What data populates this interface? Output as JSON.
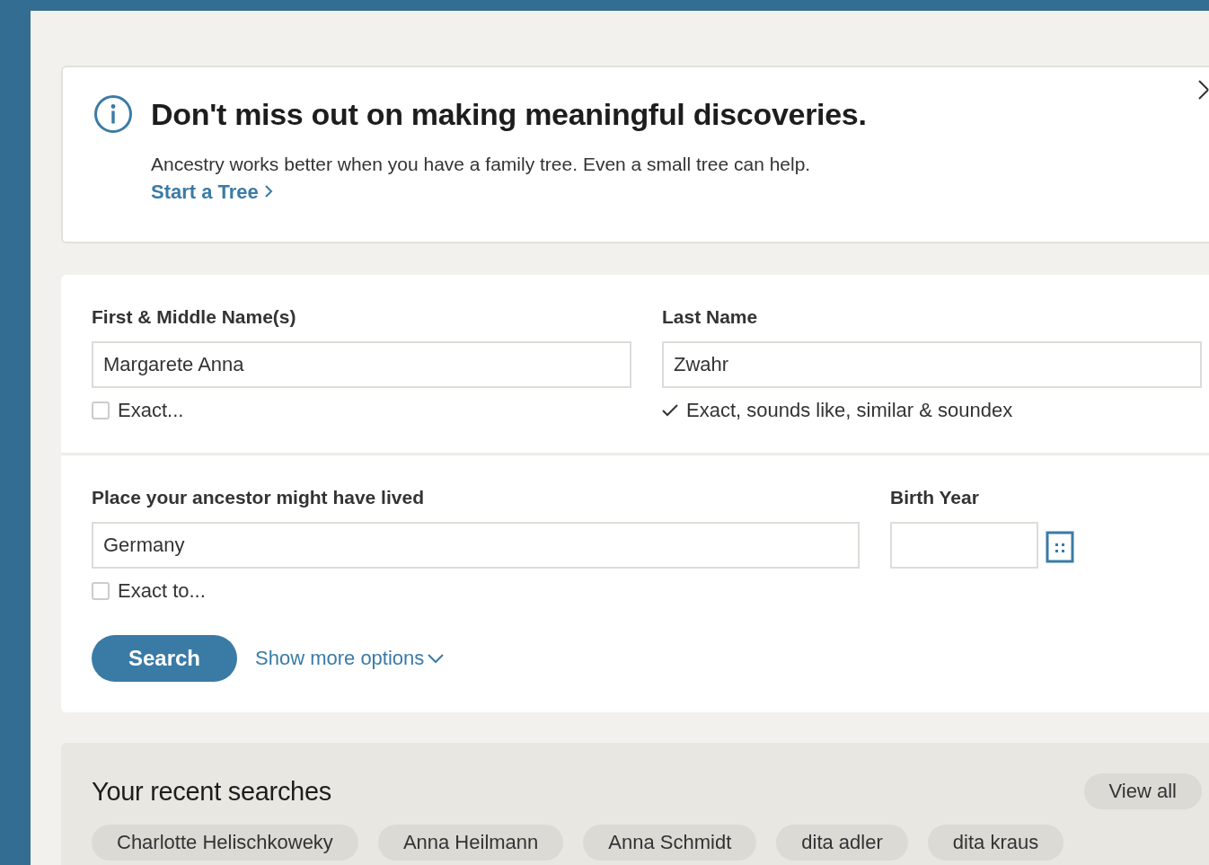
{
  "banner": {
    "title": "Don't miss out on making meaningful discoveries.",
    "message": "Ancestry works better when you have a family tree. Even a small tree can help.",
    "link": "Start a Tree"
  },
  "search_form": {
    "first_name": {
      "label": "First & Middle Name(s)",
      "value": "Margarete Anna",
      "exact": {
        "label": "Exact...",
        "checked": false
      }
    },
    "last_name": {
      "label": "Last Name",
      "value": "Zwahr",
      "match_note": "Exact, sounds like, similar & soundex"
    },
    "place": {
      "label": "Place your ancestor might have lived",
      "value": "Germany",
      "exact": {
        "label": "Exact to...",
        "checked": false
      }
    },
    "birth_year": {
      "label": "Birth Year"
    },
    "search_button": "Search",
    "more_options": "Show more options"
  },
  "recent_searches": {
    "title": "Your recent searches",
    "view_all": "View all",
    "items": [
      "Charlotte Helischkoweky",
      "Anna Heilmann",
      "Anna Schmidt",
      "dita adler",
      "dita kraus"
    ]
  }
}
